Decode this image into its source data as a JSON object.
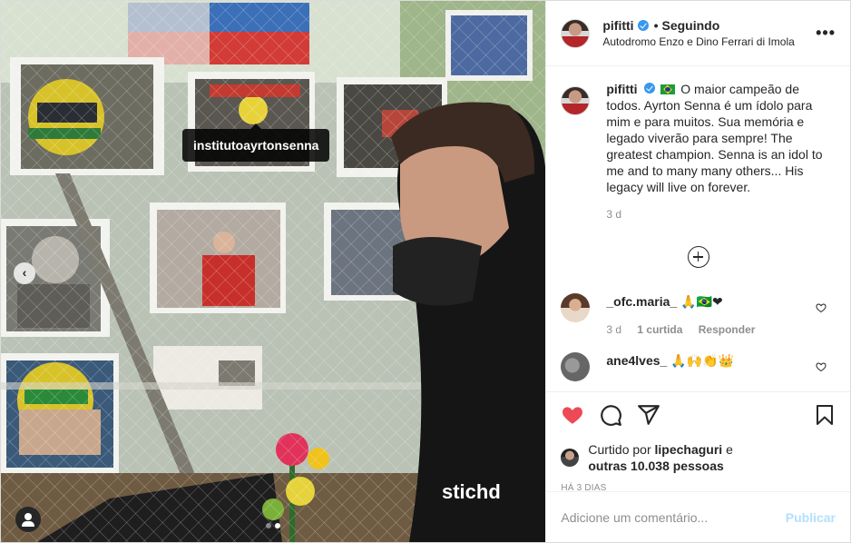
{
  "post": {
    "username": "pifitti",
    "follow_status": "Seguindo",
    "separator": "•",
    "location": "Autodromo Enzo e Dino Ferrari di Imola",
    "more_label": "•••"
  },
  "photo": {
    "tag_label": "institutoayrtonsenna",
    "prev_label": "‹",
    "jacket_text": "stichd",
    "carousel_count": 2,
    "carousel_active": 2
  },
  "caption": {
    "username": "pifitti",
    "text": "O maior campeão de todos. Ayrton Senna é um ídolo para mim e para muitos. Sua memória e legado viverão para sempre! The greatest champion. Senna is an idol to me and to many many others... His legacy will live on forever.",
    "time": "3 d"
  },
  "comments": [
    {
      "username": "_ofc.maria_",
      "text": "🙏🇧🇷❤",
      "time": "3 d",
      "likes": "1 curtida",
      "reply": "Responder"
    },
    {
      "username": "ane4lves_",
      "text": "🙏🙌👏👑"
    }
  ],
  "actions": {
    "liked_by_prefix": "Curtido por",
    "liked_by_user": "lipechaguri",
    "liked_by_and": "e",
    "others": "outras 10.038 pessoas",
    "posted_ago": "HÁ 3 DIAS"
  },
  "add_comment": {
    "placeholder": "Adicione um comentário...",
    "publish_label": "Publicar"
  },
  "colors": {
    "like_red": "#ed4956",
    "verified_blue": "#3897f0",
    "publish_disabled": "#b2dffc",
    "muted": "#8e8e8e"
  }
}
